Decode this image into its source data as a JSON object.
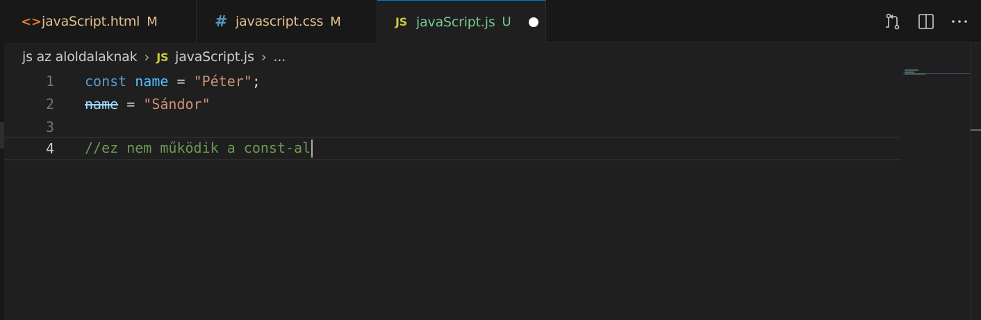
{
  "tabs": [
    {
      "icon": "<>",
      "icon_name": "html-file-icon",
      "name": "javaScript.html",
      "status": "M"
    },
    {
      "icon": "#",
      "icon_name": "css-file-icon",
      "name": "javascript.css",
      "status": "M"
    },
    {
      "icon": "JS",
      "icon_name": "js-file-icon",
      "name": "javaScript.js",
      "status": "U",
      "dirty": true
    }
  ],
  "actions": [
    "open-changes-icon",
    "split-editor-icon",
    "more-actions-icon"
  ],
  "breadcrumb": {
    "folder": "js az aloldalaknak",
    "file_icon": "JS",
    "file": "javaScript.js",
    "symbol": "..."
  },
  "editor": {
    "line_numbers": [
      "1",
      "2",
      "3",
      "4"
    ],
    "current_line": 4,
    "lines": {
      "l1": {
        "kw": "const",
        "var": "name",
        "op": " = ",
        "str": "\"Péter\"",
        "end": ";"
      },
      "l2": {
        "var": "name",
        "op": " = ",
        "str": "\"Sándor\""
      },
      "l4": {
        "comment": "//ez nem működik a const-al"
      }
    }
  },
  "colors": {
    "background": "#1f1f1f",
    "keyword": "#569cd6",
    "variable": "#4fc1ff",
    "string": "#ce9178",
    "comment": "#6a9955",
    "modified": "#e2c08d",
    "untracked": "#73c991"
  }
}
